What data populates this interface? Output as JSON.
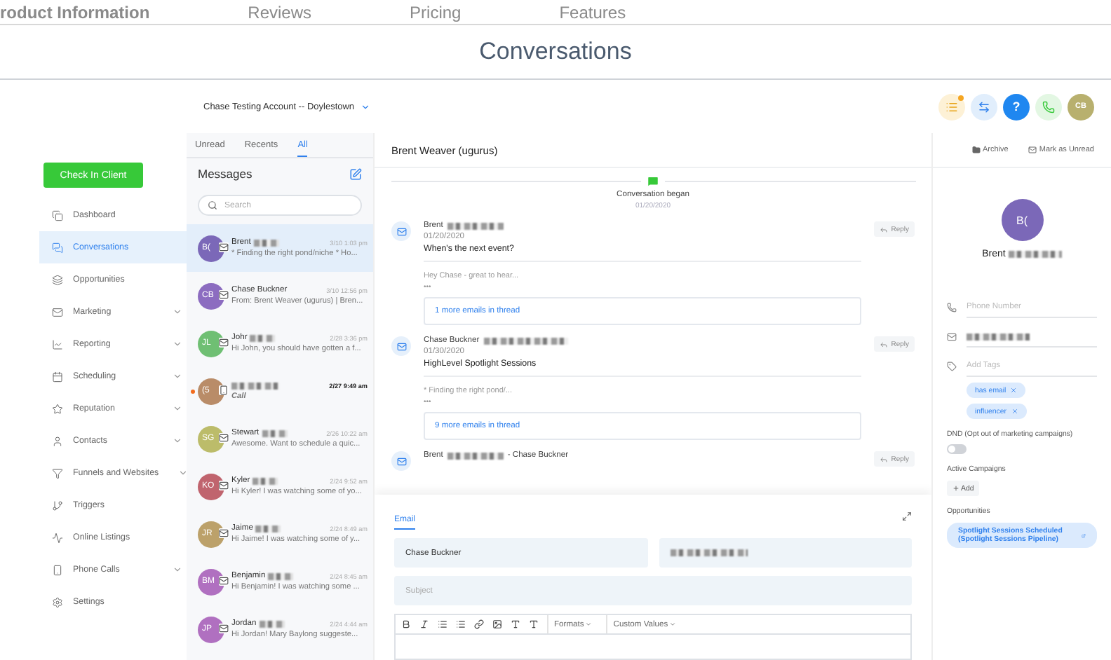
{
  "site_nav": [
    "roduct Information",
    "Reviews",
    "Pricing",
    "Features"
  ],
  "page_title": "Conversations",
  "account": {
    "name": "Chase Testing Account -- Doylestown"
  },
  "top_actions": [
    {
      "kind": "tasks",
      "badge": true
    },
    {
      "kind": "switch",
      "badge": false
    },
    {
      "kind": "help",
      "label": "?",
      "badge": false
    },
    {
      "kind": "phone",
      "badge": false
    },
    {
      "kind": "avatar",
      "label": "CB",
      "badge": false
    }
  ],
  "check_in_button": "Check In Client",
  "sidebar": {
    "items": [
      {
        "label": "Dashboard",
        "selected": false,
        "expandable": false
      },
      {
        "label": "Conversations",
        "selected": true,
        "expandable": false
      },
      {
        "label": "Opportunities",
        "selected": false,
        "expandable": false
      },
      {
        "label": "Marketing",
        "selected": false,
        "expandable": true
      },
      {
        "label": "Reporting",
        "selected": false,
        "expandable": true
      },
      {
        "label": "Scheduling",
        "selected": false,
        "expandable": true
      },
      {
        "label": "Reputation",
        "selected": false,
        "expandable": true
      },
      {
        "label": "Contacts",
        "selected": false,
        "expandable": true
      },
      {
        "label": "Funnels and Websites",
        "selected": false,
        "expandable": true
      },
      {
        "label": "Triggers",
        "selected": false,
        "expandable": false
      },
      {
        "label": "Online Listings",
        "selected": false,
        "expandable": false
      },
      {
        "label": "Phone Calls",
        "selected": false,
        "expandable": true
      },
      {
        "label": "Settings",
        "selected": false,
        "expandable": false
      }
    ]
  },
  "list_tabs": [
    {
      "label": "Unread",
      "selected": false
    },
    {
      "label": "Recents",
      "selected": false
    },
    {
      "label": "All",
      "selected": true
    }
  ],
  "messages_title": "Messages",
  "search": {
    "placeholder": "Search"
  },
  "conversations": [
    {
      "initials": "B(",
      "name": "Brent",
      "redacted": true,
      "time": "3/10 1:03 pm",
      "preview": "* Finding the right pond/niche * Ho...",
      "kind": "email",
      "color": "#7b68b8",
      "selected": true,
      "unread": false
    },
    {
      "initials": "CB",
      "name": "Chase Buckner",
      "redacted": false,
      "time": "3/10 12:56 pm",
      "preview": "From: Brent Weaver (ugurus) | Bren...",
      "kind": "email",
      "color": "#8c6cc0",
      "selected": false,
      "unread": false
    },
    {
      "initials": "JL",
      "name": "Johr",
      "redacted": true,
      "time": "2/28 3:36 pm",
      "preview": "Hi John, you should have gotten a f...",
      "kind": "email",
      "color": "#6fbf73",
      "selected": false,
      "unread": false
    },
    {
      "initials": "(5",
      "redacted": true,
      "time": "2/27 9:49 am",
      "preview": "Call",
      "kind": "phone",
      "color": "#b98c68",
      "selected": false,
      "unread": true
    },
    {
      "initials": "SG",
      "name": "Stewart",
      "redacted": true,
      "time": "2/26 10:22 am",
      "preview": "Awesome. Want to schedule a quic...",
      "kind": "email",
      "color": "#bcbc6a",
      "selected": false,
      "unread": false
    },
    {
      "initials": "KO",
      "name": "Kyler",
      "redacted": true,
      "time": "2/24 9:52 am",
      "preview": "Hi Kyler! I was watching some of yo...",
      "kind": "email",
      "color": "#c0646e",
      "selected": false,
      "unread": false
    },
    {
      "initials": "JR",
      "name": "Jaime",
      "redacted": true,
      "time": "2/24 8:49 am",
      "preview": "Hi Jaime! I was watching some of y...",
      "kind": "email",
      "color": "#bca16a",
      "selected": false,
      "unread": false
    },
    {
      "initials": "BM",
      "name": "Benjamin",
      "redacted": true,
      "time": "2/24 8:45 am",
      "preview": "Hi Benjamin! I was watching some ...",
      "kind": "email",
      "color": "#b070c0",
      "selected": false,
      "unread": false
    },
    {
      "initials": "JP",
      "name": "Jordan",
      "redacted": true,
      "time": "2/24 4:44 am",
      "preview": "Hi Jordan! Mary Baylong suggeste...",
      "kind": "email",
      "color": "#b070c0",
      "selected": false,
      "unread": false
    }
  ],
  "conversation": {
    "title": "Brent Weaver (ugurus)",
    "actions": [
      "Archive",
      "Mark as Unread"
    ],
    "began": {
      "label": "Conversation began",
      "date": "01/20/2020"
    },
    "messages": [
      {
        "from": "Brent",
        "from_redacted": true,
        "date": "01/20/2020",
        "subject": "When's the next event?",
        "snippet": "Hey Chase - great to hear...",
        "ellipsis": "•••",
        "thread": "1 more emails in thread",
        "reply": "Reply"
      },
      {
        "from": "Chase Buckner",
        "from_redacted": true,
        "date": "01/30/2020",
        "subject": "HighLevel Spotlight Sessions",
        "snippet": "* Finding the right pond/...",
        "ellipsis": "•••",
        "thread": "9 more emails in thread",
        "reply": "Reply"
      },
      {
        "from": "Brent",
        "from_redacted": true,
        "to": "- Chase Buckner",
        "reply": "Reply"
      }
    ]
  },
  "composer": {
    "tabs": [
      {
        "label": "Email",
        "selected": true
      }
    ],
    "from": "Chase Buckner",
    "subject_placeholder": "Subject",
    "toolbar": [
      "Formats",
      "Custom Values"
    ]
  },
  "contact": {
    "initials": "B(",
    "name": "Brent",
    "fields": [
      {
        "kind": "phone",
        "placeholder": "Phone Number",
        "redacted": false
      },
      {
        "kind": "email",
        "redacted": true
      },
      {
        "kind": "tags",
        "placeholder": "Add Tags",
        "redacted": false
      }
    ],
    "tags": [
      "has email",
      "influencer"
    ],
    "dnd": {
      "label": "DND (Opt out of marketing campaigns)",
      "on": false
    },
    "campaigns": {
      "label": "Active Campaigns",
      "button": "Add"
    },
    "opportunities": {
      "label": "Opportunities",
      "items": [
        "Spotlight Sessions Scheduled (Spotlight Sessions Pipeline)"
      ]
    }
  }
}
